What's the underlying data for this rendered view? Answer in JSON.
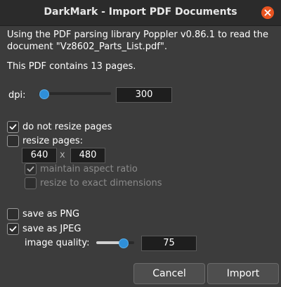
{
  "window": {
    "title": "DarkMark - Import PDF Documents",
    "close_icon": "close-icon",
    "accent": "#e95420"
  },
  "intro": {
    "line1": "Using the PDF parsing library Poppler v0.86.1 to read the",
    "line2": "document \"Vz8602_Parts_List.pdf\"."
  },
  "pages_text": "This PDF contains 13 pages.",
  "dpi": {
    "label": "dpi:",
    "value": "300",
    "slider_fraction": 0.03
  },
  "resize": {
    "do_not_resize": {
      "label": "do not resize pages",
      "checked": true
    },
    "resize_pages": {
      "label": "resize pages:",
      "checked": false
    },
    "width": "640",
    "separator": "x",
    "height": "480",
    "maintain_aspect": {
      "label": "maintain aspect ratio",
      "checked": true,
      "enabled": false
    },
    "exact_dimensions": {
      "label": "resize to exact dimensions",
      "checked": false,
      "enabled": false
    }
  },
  "output": {
    "png": {
      "label": "save as PNG",
      "checked": false
    },
    "jpeg": {
      "label": "save as JPEG",
      "checked": true
    },
    "quality_label": "image quality:",
    "quality_value": "75",
    "quality_fraction": 0.75
  },
  "buttons": {
    "cancel": "Cancel",
    "import": "Import"
  }
}
